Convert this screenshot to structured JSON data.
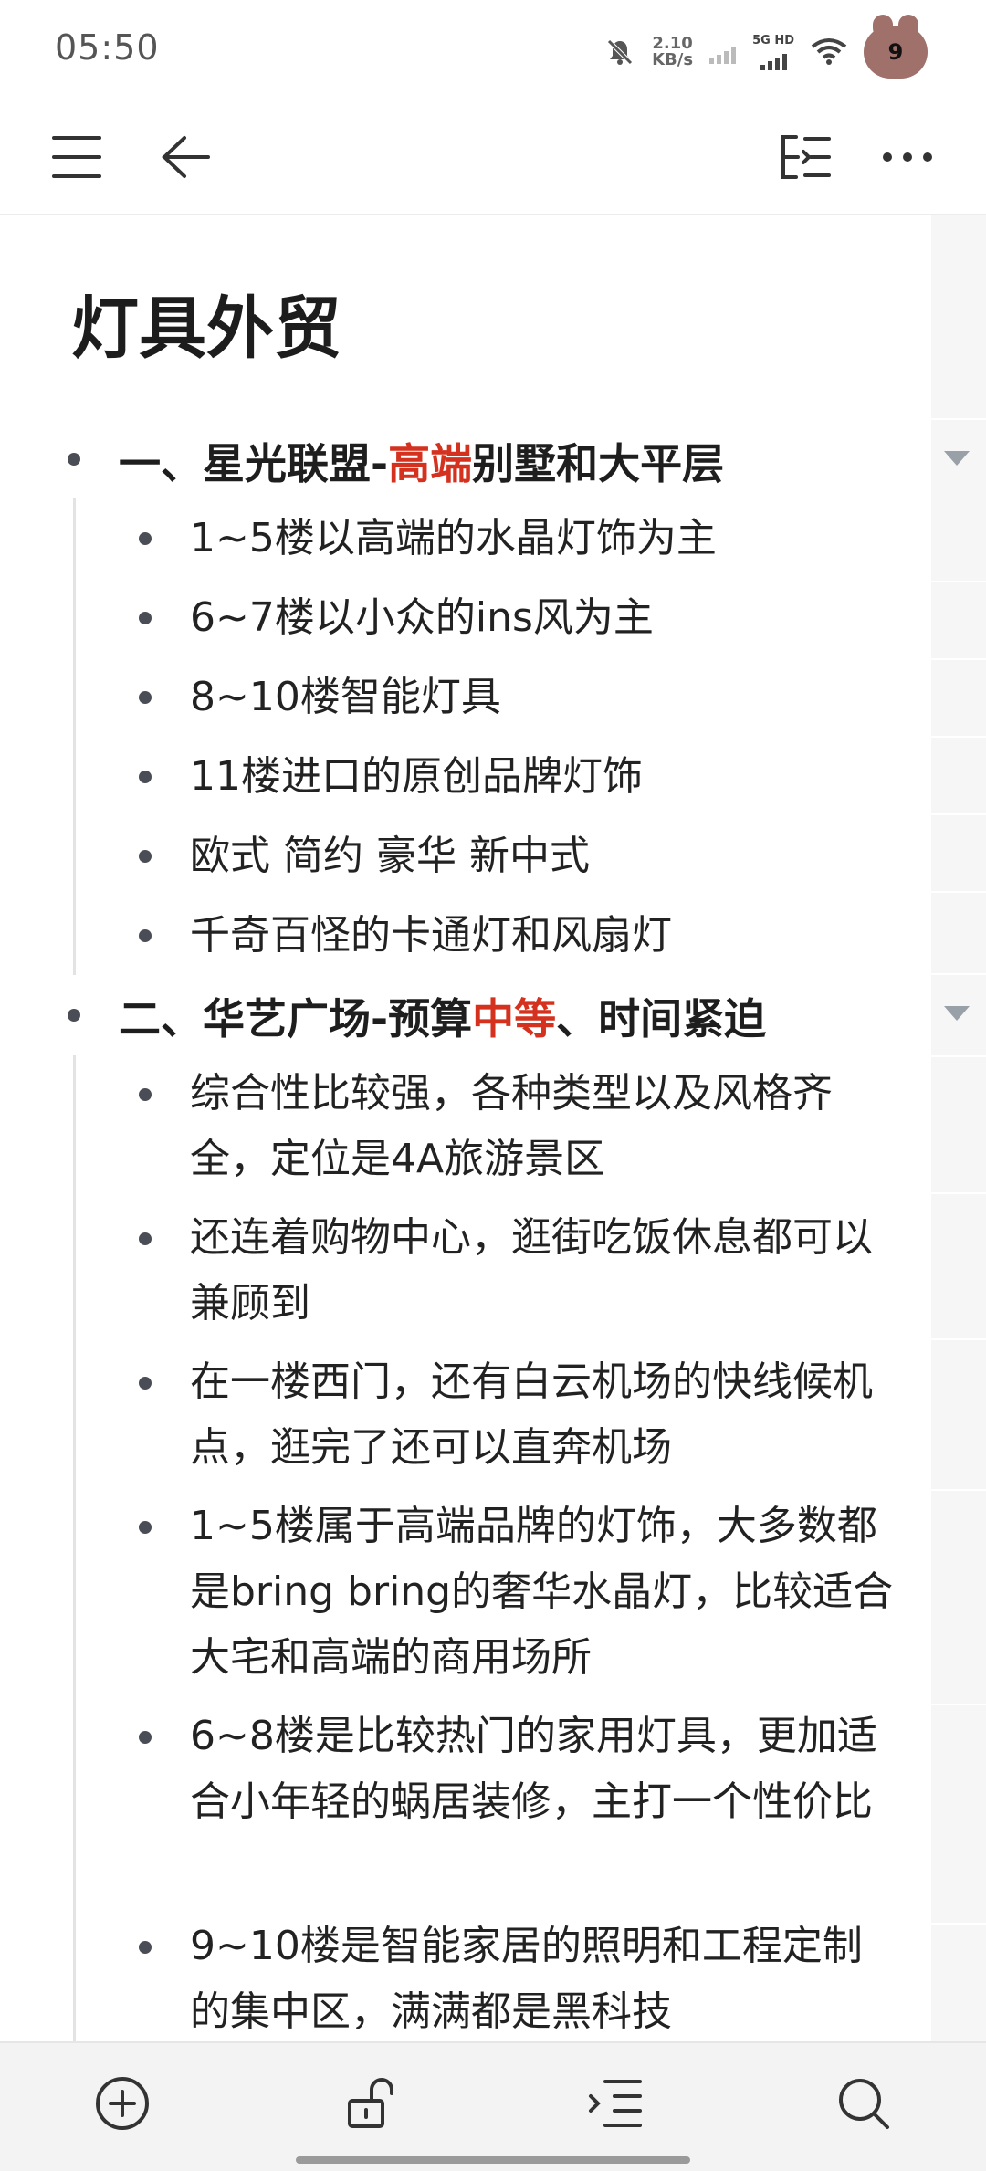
{
  "status": {
    "time": "05:50",
    "net_speed_value": "2.10",
    "net_speed_unit": "KB/s",
    "network_tag": "5G HD",
    "badge_count": "9"
  },
  "document": {
    "title": "灯具外贸",
    "sections": [
      {
        "heading_prefix": "一、星光联盟-",
        "heading_highlight": "高端",
        "heading_suffix": "别墅和大平层",
        "items": [
          "1~5楼以高端的水晶灯饰为主",
          "6~7楼以小众的ins风为主",
          "8~10楼智能灯具",
          "11楼进口的原创品牌灯饰",
          "欧式 简约 豪华 新中式",
          "千奇百怪的卡通灯和风扇灯"
        ]
      },
      {
        "heading_prefix": "二、华艺广场-预算",
        "heading_highlight": "中等",
        "heading_suffix": "、时间紧迫",
        "items": [
          "综合性比较强，各种类型以及风格齐全，定位是4A旅游景区",
          "还连着购物中心，逛街吃饭休息都可以兼顾到",
          "在一楼西门，还有白云机场的快线候机点，逛完了还可以直奔机场",
          "1~5楼属于高端品牌的灯饰，大多数都是bring bring的奢华水晶灯，比较适合大宅和高端的商用场所",
          "6~8楼是比较热门的家用灯具，更加适合小年轻的蜗居装修，主打一个性价比",
          "9~10楼是智能家居的照明和工程定制的集中区，满满都是黑科技"
        ]
      }
    ]
  },
  "colors": {
    "highlight": "#d4321f",
    "gutter": "#f6f6f6",
    "bottom_bar": "#f3f3f3"
  },
  "icons": {
    "toolbar": [
      "menu-icon",
      "back-icon",
      "outline-icon",
      "more-icon"
    ],
    "bottombar": [
      "add-icon",
      "unlock-icon",
      "indent-icon",
      "search-icon"
    ]
  }
}
